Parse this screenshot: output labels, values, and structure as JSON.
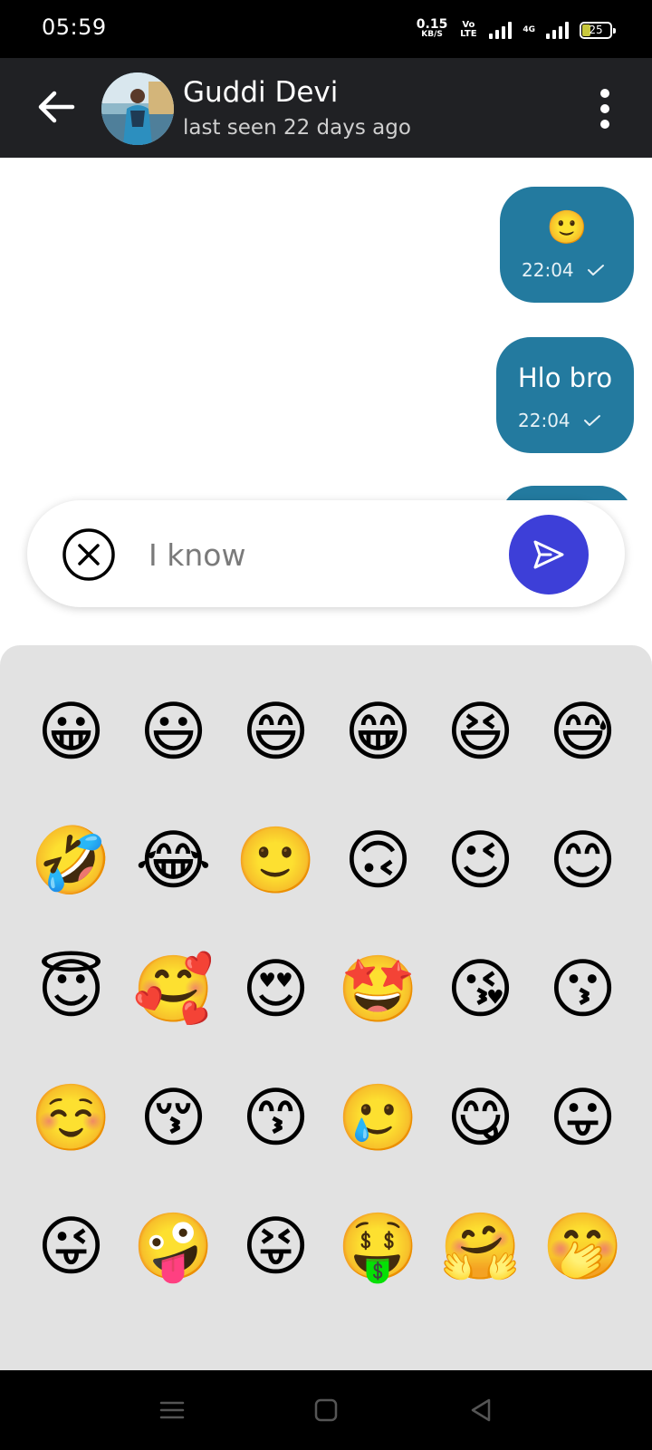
{
  "status_bar": {
    "time": "05:59",
    "net_speed_value": "0.15",
    "net_speed_unit": "KB/S",
    "volte_label": "Vo LTE",
    "network_label": "4G",
    "battery_level": "25"
  },
  "header": {
    "contact_name": "Guddi Devi",
    "last_seen": "last seen 22 days ago"
  },
  "messages": [
    {
      "text": "🙂",
      "time": "22:04",
      "status": "sent"
    },
    {
      "text": "Hlo bro",
      "time": "22:04",
      "status": "sent"
    },
    {
      "text": "",
      "time": "",
      "status": "sent"
    }
  ],
  "composer": {
    "value": "I know"
  },
  "emoji_panel": {
    "emojis": [
      "😀",
      "😃",
      "😄",
      "😁",
      "😆",
      "😅",
      "🤣",
      "😂",
      "🙂",
      "🙃",
      "😉",
      "😊",
      "😇",
      "🥰",
      "😍",
      "🤩",
      "😘",
      "😗",
      "☺️",
      "😚",
      "😙",
      "🥲",
      "😋",
      "😛",
      "😜",
      "🤪",
      "😝",
      "🤑",
      "🤗",
      "🤭",
      "🤫",
      "🤔",
      "🤐",
      "🤨",
      "😐",
      "😑"
    ]
  },
  "colors": {
    "header_bg": "#202124",
    "bubble_bg": "#237a9f",
    "send_button": "#3d3fd8",
    "emoji_panel_bg": "#e2e2e2"
  },
  "icons": {
    "back": "arrow-left-icon",
    "menu": "more-vertical-icon",
    "clear": "close-circle-icon",
    "send": "send-icon",
    "check": "check-icon"
  }
}
